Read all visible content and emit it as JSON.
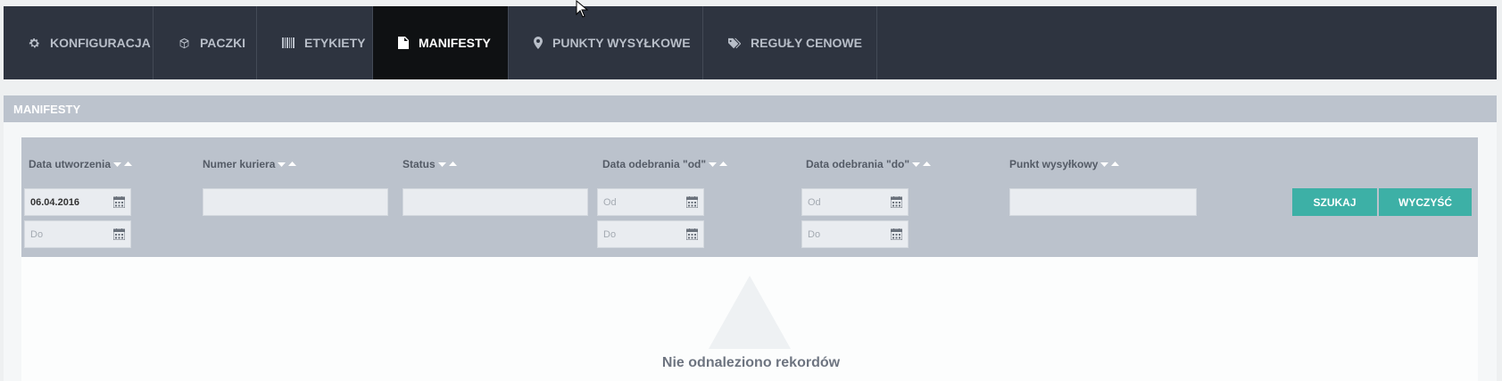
{
  "tabs": [
    {
      "label": "KONFIGURACJA",
      "icon": "gear-icon"
    },
    {
      "label": "PACZKI",
      "icon": "package-icon"
    },
    {
      "label": "ETYKIETY",
      "icon": "barcode-icon"
    },
    {
      "label": "MANIFESTY",
      "icon": "document-icon",
      "active": true
    },
    {
      "label": "PUNKTY WYSYŁKOWE",
      "icon": "map-pin-icon"
    },
    {
      "label": "REGUŁY CENOWE",
      "icon": "tags-icon"
    }
  ],
  "panel": {
    "title": "MANIFESTY"
  },
  "filters": {
    "created_date": {
      "label": "Data utworzenia",
      "from_value": "06.04.2016",
      "to_placeholder": "Do"
    },
    "courier_number": {
      "label": "Numer kuriera",
      "value": ""
    },
    "status": {
      "label": "Status",
      "value": ""
    },
    "pickup_from": {
      "label": "Data odebrania \"od\"",
      "from_placeholder": "Od",
      "to_placeholder": "Do"
    },
    "pickup_to": {
      "label": "Data odebrania \"do\"",
      "from_placeholder": "Od",
      "to_placeholder": "Do"
    },
    "shipping_point": {
      "label": "Punkt wysyłkowy",
      "value": ""
    }
  },
  "buttons": {
    "search": "SZUKAJ",
    "clear": "WYCZYŚĆ"
  },
  "empty_state": {
    "message": "Nie odnaleziono rekordów",
    "icon": "warning-icon"
  },
  "colors": {
    "topbar": "#2e3440",
    "active_tab": "#0f1113",
    "panel_header": "#bcc3cd",
    "accent_button": "#3db0a6"
  }
}
